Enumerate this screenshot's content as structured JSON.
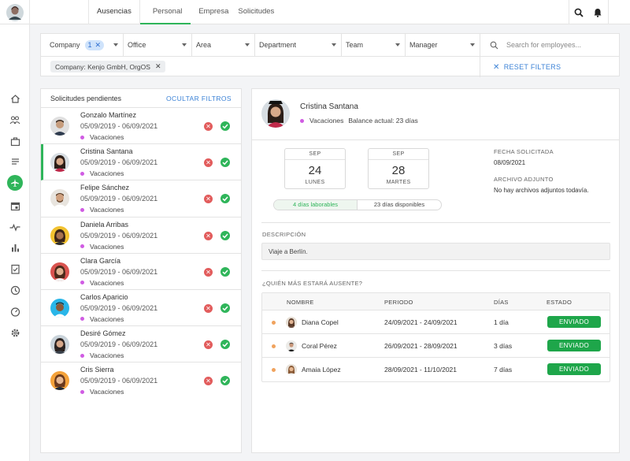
{
  "header": {
    "tabs": [
      {
        "label": "Ausencias"
      },
      {
        "label": "Personal"
      },
      {
        "label": "Empresa"
      },
      {
        "label": "Solicitudes"
      }
    ]
  },
  "filters": {
    "company": {
      "label": "Company",
      "count": "1"
    },
    "office": {
      "label": "Office"
    },
    "area": {
      "label": "Area"
    },
    "department": {
      "label": "Department"
    },
    "team": {
      "label": "Team"
    },
    "manager": {
      "label": "Manager"
    },
    "search_placeholder": "Search for employees...",
    "active_chip": "Company: Kenjo GmbH, OrgOS",
    "reset_label": "RESET FILTERS"
  },
  "requests": {
    "title": "Solicitudes pendientes",
    "hide_filters": "OCULTAR FILTROS",
    "items": [
      {
        "name": "Gonzalo Martínez",
        "dates": "05/09/2019 - 06/09/2021",
        "type": "Vacaciones"
      },
      {
        "name": "Cristina Santana",
        "dates": "05/09/2019 - 06/09/2021",
        "type": "Vacaciones"
      },
      {
        "name": "Felipe Sánchez",
        "dates": "05/09/2019 - 06/09/2021",
        "type": "Vacaciones"
      },
      {
        "name": "Daniela Arribas",
        "dates": "05/09/2019 - 06/09/2021",
        "type": "Vacaciones"
      },
      {
        "name": "Clara García",
        "dates": "05/09/2019 - 06/09/2021",
        "type": "Vacaciones"
      },
      {
        "name": "Carlos Aparicio",
        "dates": "05/09/2019 - 06/09/2021",
        "type": "Vacaciones"
      },
      {
        "name": "Desiré Gómez",
        "dates": "05/09/2019 - 06/09/2021",
        "type": "Vacaciones"
      },
      {
        "name": "Cris Sierra",
        "dates": "05/09/2019 - 06/09/2021",
        "type": "Vacaciones"
      }
    ]
  },
  "detail": {
    "name": "Cristina Santana",
    "type": "Vacaciones",
    "balance": "Balance actual: 23 días",
    "start": {
      "month": "SEP",
      "day": "24",
      "weekday": "LUNES"
    },
    "end": {
      "month": "SEP",
      "day": "28",
      "weekday": "MARTES"
    },
    "working_days": "4 días laborables",
    "available_days": "23 días disponibles",
    "requested_label": "FECHA SOLICITADA",
    "requested_value": "08/09/2021",
    "attachment_label": "ARCHIVO ADJUNTO",
    "attachment_value": "No hay archivos adjuntos todavía.",
    "description_label": "DESCRIPCIÓN",
    "description_value": "Viaje a Berlín.",
    "absent_label": "¿QUIÉN MÁS ESTARÁ AUSENTE?",
    "table": {
      "headers": {
        "name": "NOMBRE",
        "period": "PERIODO",
        "days": "DÍAS",
        "status": "ESTADO"
      },
      "rows": [
        {
          "name": "Diana Copel",
          "period": "24/09/2021 - 24/09/2021",
          "days": "1 día",
          "status": "ENVIADO"
        },
        {
          "name": "Coral Pérez",
          "period": "26/09/2021 - 28/09/2021",
          "days": "3 días",
          "status": "ENVIADO"
        },
        {
          "name": "Amaia López",
          "period": "28/09/2021 - 11/10/2021",
          "days": "7 días",
          "status": "ENVIADO"
        }
      ]
    }
  },
  "colors": {
    "accent_green": "#2fb55a",
    "link_blue": "#3b82d6",
    "vacation_dot": "#d05ce3",
    "reject_red": "#e25c5c",
    "absent_dot": "#f0a35e"
  },
  "icons": [
    "search-icon",
    "bell-icon",
    "home-icon",
    "people-icon",
    "briefcase-icon",
    "document-icon",
    "airplane-icon",
    "calendar-icon",
    "pulse-icon",
    "bar-chart-icon",
    "checklist-icon",
    "clock-icon",
    "gauge-icon",
    "gear-icon"
  ]
}
